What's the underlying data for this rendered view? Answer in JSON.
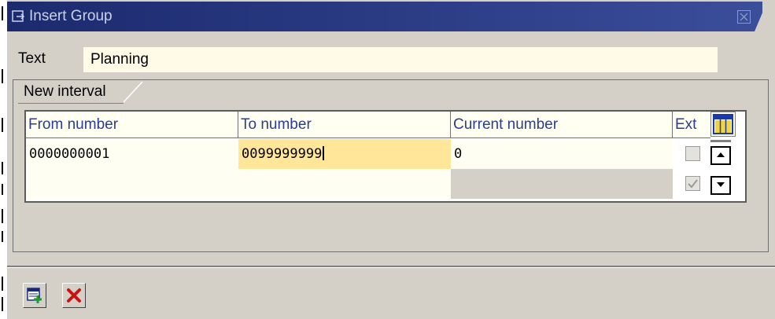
{
  "window": {
    "title": "Insert Group",
    "icons": {
      "title": "dialog-icon",
      "close": "close-icon"
    }
  },
  "form": {
    "text_label": "Text",
    "text_value": "Planning"
  },
  "group": {
    "tab_label": "New interval"
  },
  "table": {
    "columns": [
      "From number",
      "To number",
      "Current number",
      "Ext"
    ],
    "rows": [
      {
        "from": "0000000001",
        "to": "0099999999",
        "current": "0",
        "ext_checked": false
      },
      {
        "from": "",
        "to": "",
        "current": "",
        "ext_checked": true
      }
    ]
  },
  "footer": {
    "buttons": [
      {
        "name": "insert-button",
        "icon": "insert-row-icon"
      },
      {
        "name": "cancel-button",
        "icon": "cancel-x-icon"
      }
    ]
  },
  "colors": {
    "title_bar": "#2c3d86",
    "dialog_bg": "#d4d0c8",
    "input_bg": "#fffbe6",
    "active_cell": "#ffe698",
    "header_text": "#2a3d8f",
    "cancel_red": "#cc1111"
  }
}
